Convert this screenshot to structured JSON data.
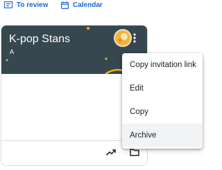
{
  "top_nav": {
    "to_review": {
      "label": "To review",
      "icon": "review-list-icon"
    },
    "calendar": {
      "label": "Calendar",
      "icon": "calendar-icon"
    }
  },
  "class_card": {
    "title": "K-pop Stans",
    "subtitle": "A",
    "header_color": "#37474f",
    "actions": [
      {
        "icon": "trending-up-icon"
      },
      {
        "icon": "folder-icon"
      }
    ]
  },
  "context_menu": {
    "items": [
      {
        "label": "Copy invitation link"
      },
      {
        "label": "Edit"
      },
      {
        "label": "Copy"
      },
      {
        "label": "Archive",
        "highlighted": true
      }
    ]
  },
  "colors": {
    "accent": "#1967d2",
    "menu_highlight": "#f1f3f4",
    "avatar": "#f3b33d"
  }
}
